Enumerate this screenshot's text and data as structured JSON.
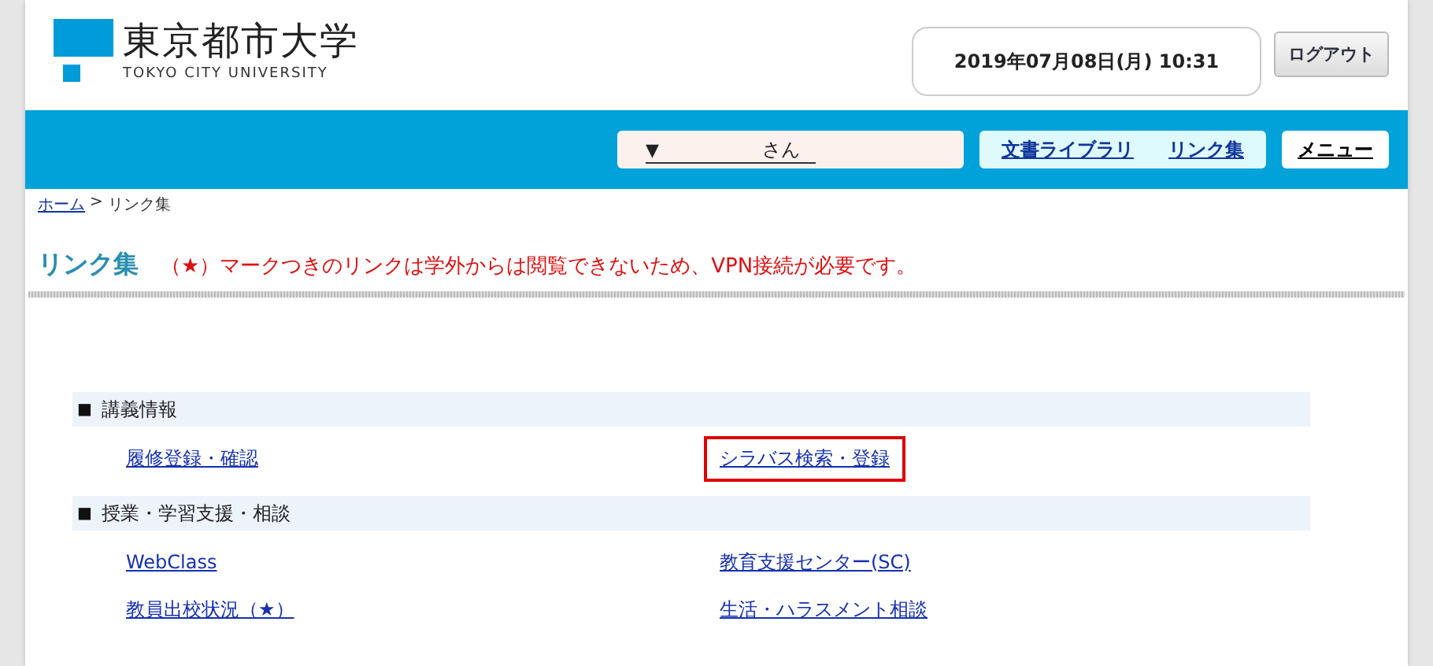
{
  "logo": {
    "name": "東京都市大学",
    "english": "TOKYO CITY UNIVERSITY"
  },
  "header": {
    "datetime": "2019年07月08日(月) 10:31",
    "logout": "ログアウト"
  },
  "nav": {
    "user_caret": "▼",
    "user_suffix": "さん",
    "links": [
      "文書ライブラリ",
      "リンク集"
    ],
    "menu": "メニュー"
  },
  "breadcrumb": [
    {
      "label": "ホーム",
      "link": true
    },
    {
      "label": ">",
      "link": false
    },
    {
      "label": "リンク集",
      "link": false
    }
  ],
  "title": "リンク集",
  "notice": "（★）マークつきのリンクは学外からは閲覧できないため、VPN接続が必要です。",
  "sections": [
    {
      "bullet": "■",
      "heading": "講義情報",
      "links": [
        {
          "label": "履修登録・確認",
          "highlighted": false
        },
        {
          "label": "シラバス検索・登録",
          "highlighted": true
        }
      ]
    },
    {
      "bullet": "■",
      "heading": "授業・学習支援・相談",
      "links": [
        {
          "label": "WebClass",
          "highlighted": false
        },
        {
          "label": "教育支援センター(SC)",
          "highlighted": false
        },
        {
          "label": "教員出校状況（★）",
          "highlighted": false
        },
        {
          "label": "生活・ハラスメント相談",
          "highlighted": false
        }
      ]
    }
  ]
}
